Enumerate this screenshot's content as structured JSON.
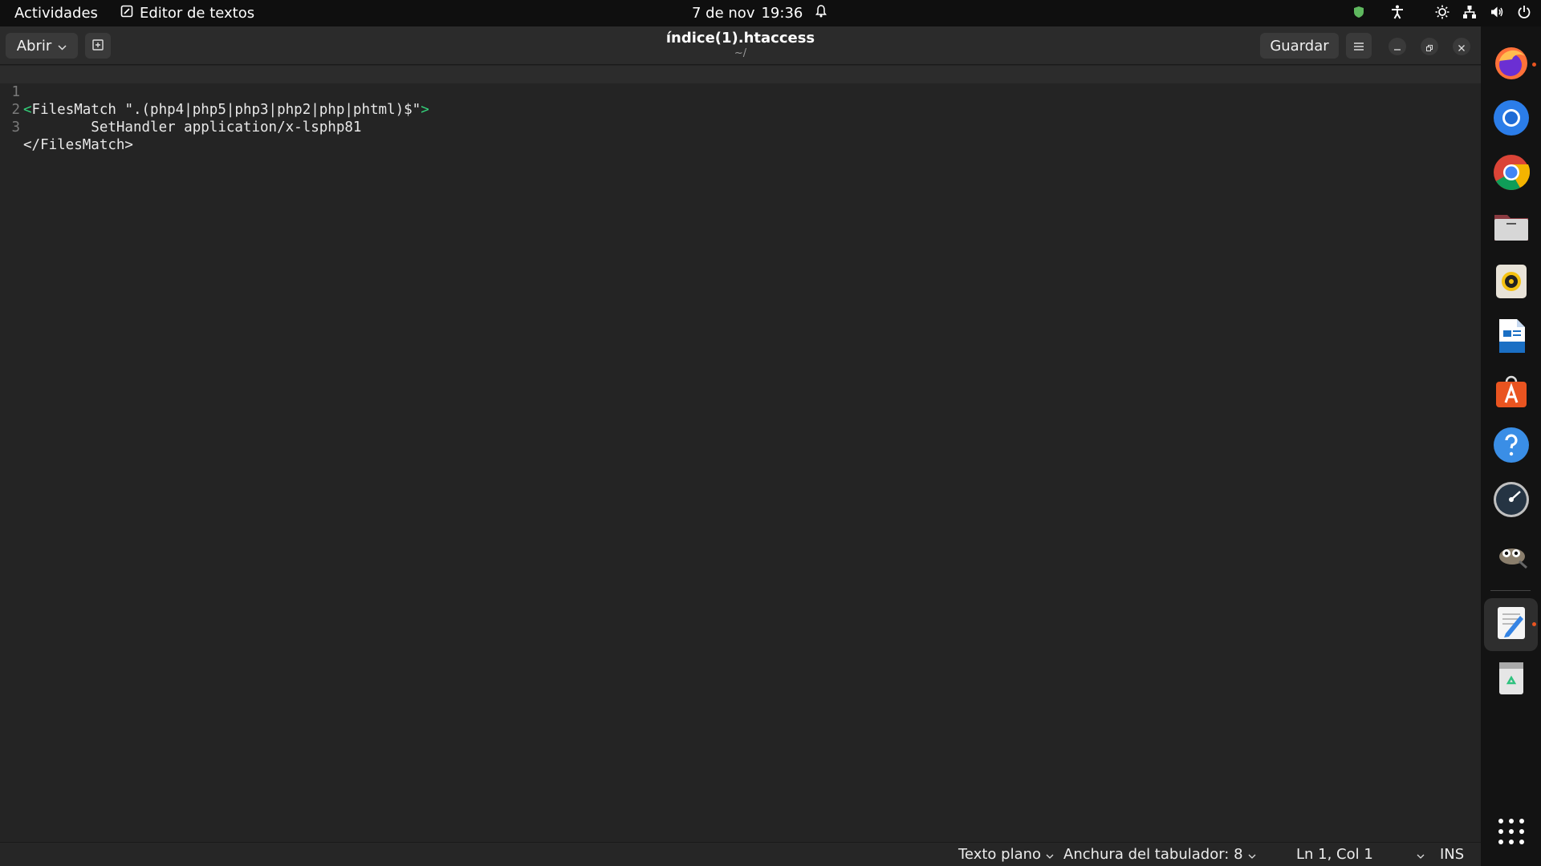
{
  "topbar": {
    "activities": "Actividades",
    "app_name": "Editor de textos",
    "date": "7 de nov",
    "time": "19:36"
  },
  "header": {
    "open_label": "Abrir",
    "title": "índice(1).htaccess",
    "subtitle": "~/",
    "save_label": "Guardar"
  },
  "editor": {
    "lines": [
      {
        "number": "1",
        "open_bracket": "<",
        "text": "FilesMatch \".(php4|php5|php3|php2|php|phtml)$\"",
        "close_bracket": ">"
      },
      {
        "number": "2",
        "text": "        SetHandler application/x-lsphp81"
      },
      {
        "number": "3",
        "text": "</FilesMatch>"
      }
    ]
  },
  "status": {
    "language": "Texto plano",
    "tab_width": "Anchura del tabulador: 8",
    "position": "Ln 1, Col 1",
    "mode": "INS"
  },
  "dock": {
    "items": [
      "firefox-icon",
      "chromium-icon",
      "chrome-icon",
      "files-icon",
      "rhythmbox-icon",
      "libreoffice-writer-icon",
      "app-center-icon",
      "help-icon",
      "speedtest-icon",
      "gimp-icon",
      "text-editor-icon",
      "trash-icon",
      "show-apps-icon"
    ]
  },
  "colors": {
    "bracket_match": "#33d17a",
    "running_dot": "#e95420"
  }
}
